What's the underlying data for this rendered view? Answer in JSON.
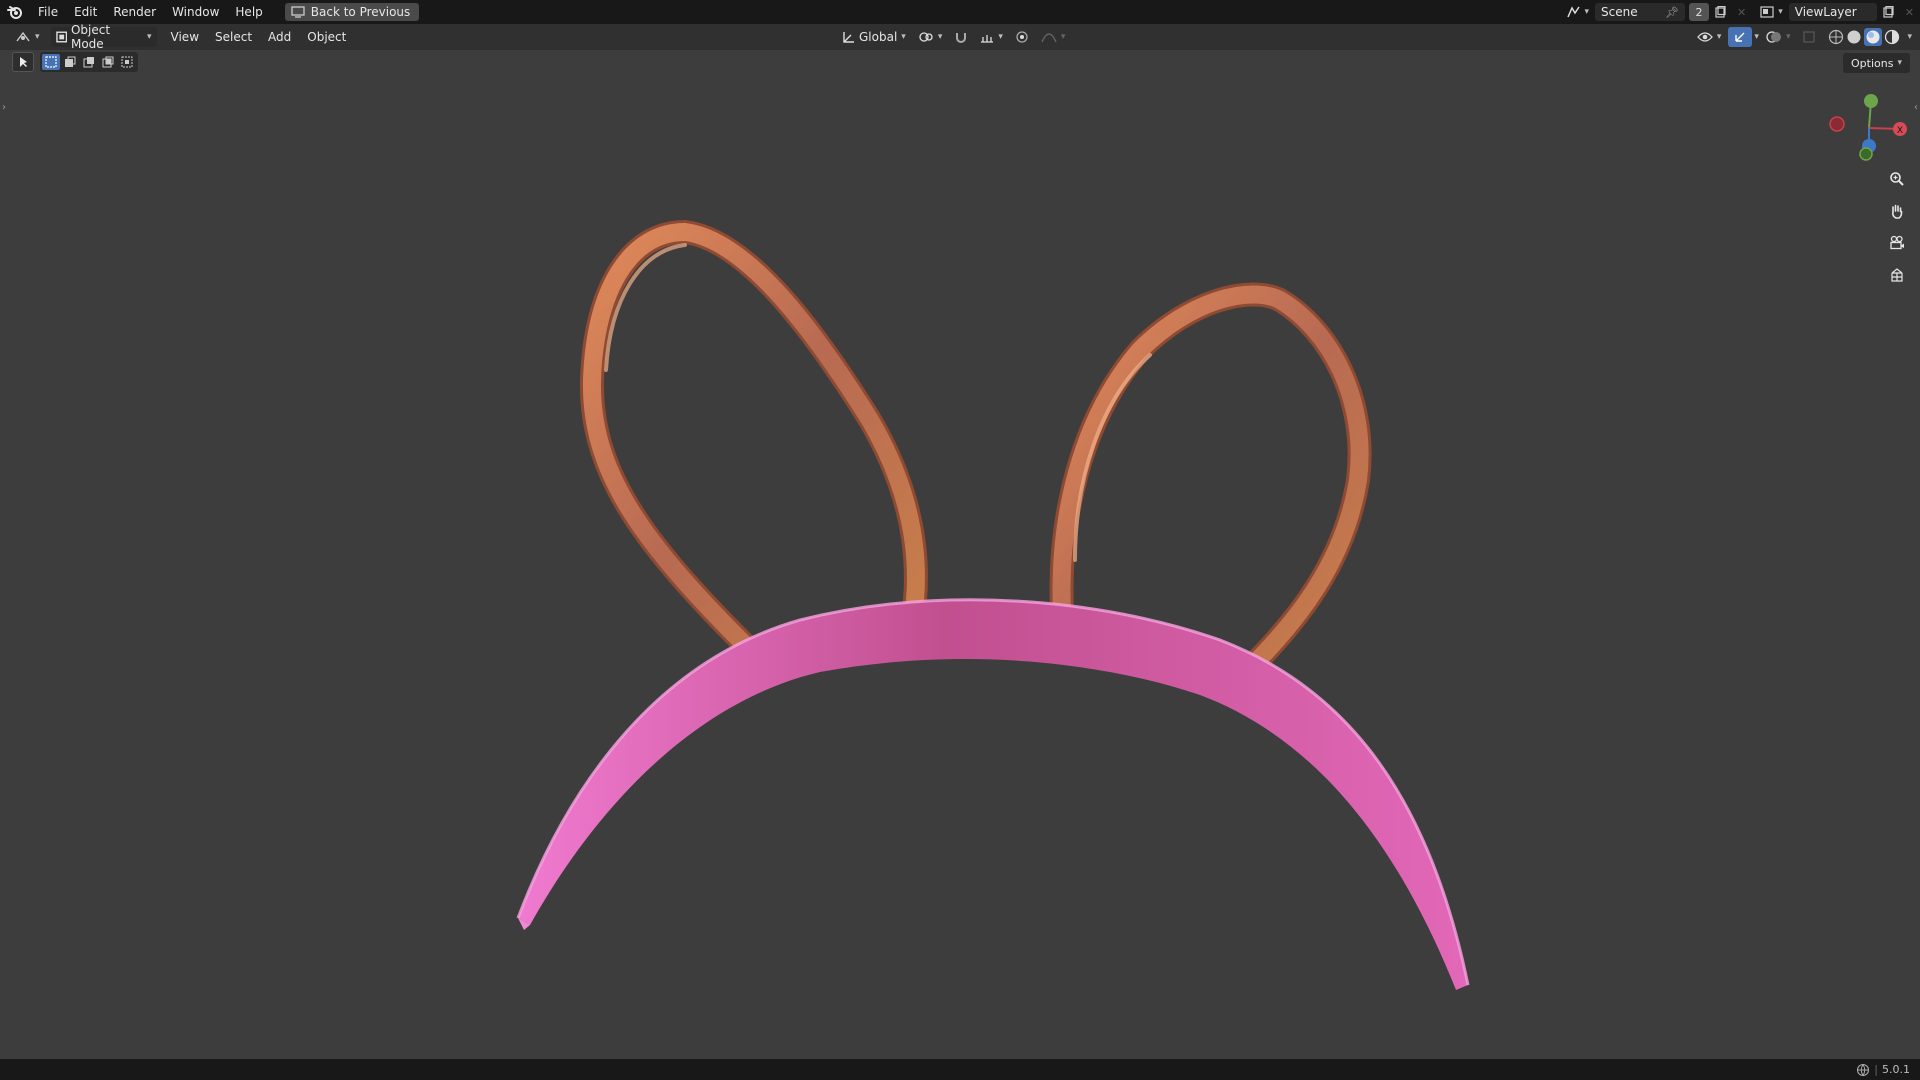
{
  "menubar": {
    "items": [
      "File",
      "Edit",
      "Render",
      "Window",
      "Help"
    ],
    "back_label": "Back to Previous"
  },
  "topright": {
    "scene": "Scene",
    "scene_users": "2",
    "view_layer": "ViewLayer"
  },
  "header": {
    "mode": "Object Mode",
    "menus": [
      "View",
      "Select",
      "Add",
      "Object"
    ],
    "transform_orientation": "Global"
  },
  "options_label": "Options",
  "version": "5.0.1",
  "gizmo": {
    "x": "X",
    "y": "Y",
    "z": "Z"
  },
  "colors": {
    "headband": "#e865c2",
    "ears": "#c8784e",
    "background": "#3d3d3d",
    "accent": "#4772b3"
  },
  "icons": {
    "nav": [
      "zoom-icon",
      "hand-pan-icon",
      "camera-view-icon",
      "ortho-grid-icon"
    ]
  }
}
